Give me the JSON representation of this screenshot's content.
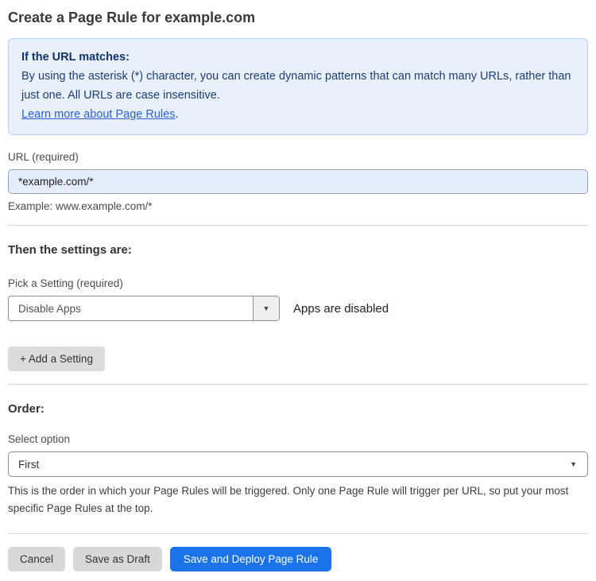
{
  "page": {
    "title": "Create a Page Rule for example.com"
  },
  "info_box": {
    "heading": "If the URL matches:",
    "body": "By using the asterisk (*) character, you can create dynamic patterns that can match many URLs, rather than just one. All URLs are case insensitive.",
    "link_label": "Learn more about Page Rules",
    "link_suffix": "."
  },
  "url_field": {
    "label": "URL (required)",
    "value": "*example.com/*",
    "example": "Example: www.example.com/*"
  },
  "settings_section": {
    "heading": "Then the settings are:",
    "setting_label": "Pick a Setting (required)",
    "setting_value": "Disable Apps",
    "setting_status": "Apps are disabled",
    "add_setting_label": "+ Add a Setting"
  },
  "order_section": {
    "heading": "Order:",
    "select_label": "Select option",
    "select_value": "First",
    "help_text": "This is the order in which your Page Rules will be triggered. Only one Page Rule will trigger per URL, so put your most specific Page Rules at the top."
  },
  "footer": {
    "cancel_label": "Cancel",
    "save_draft_label": "Save as Draft",
    "save_deploy_label": "Save and Deploy Page Rule"
  },
  "icons": {
    "dropdown_arrow": "▼",
    "select_caret": "▼"
  },
  "colors": {
    "info_bg": "#e8f0fb",
    "info_border": "#b8d0f0",
    "info_heading_text": "#12326e",
    "info_body_text": "#1e3e78",
    "link_blue": "#2b5fd9",
    "url_input_bg": "#e3edfc",
    "primary_button_blue": "#1a73e8",
    "secondary_button_gray": "#d8d8d8"
  }
}
